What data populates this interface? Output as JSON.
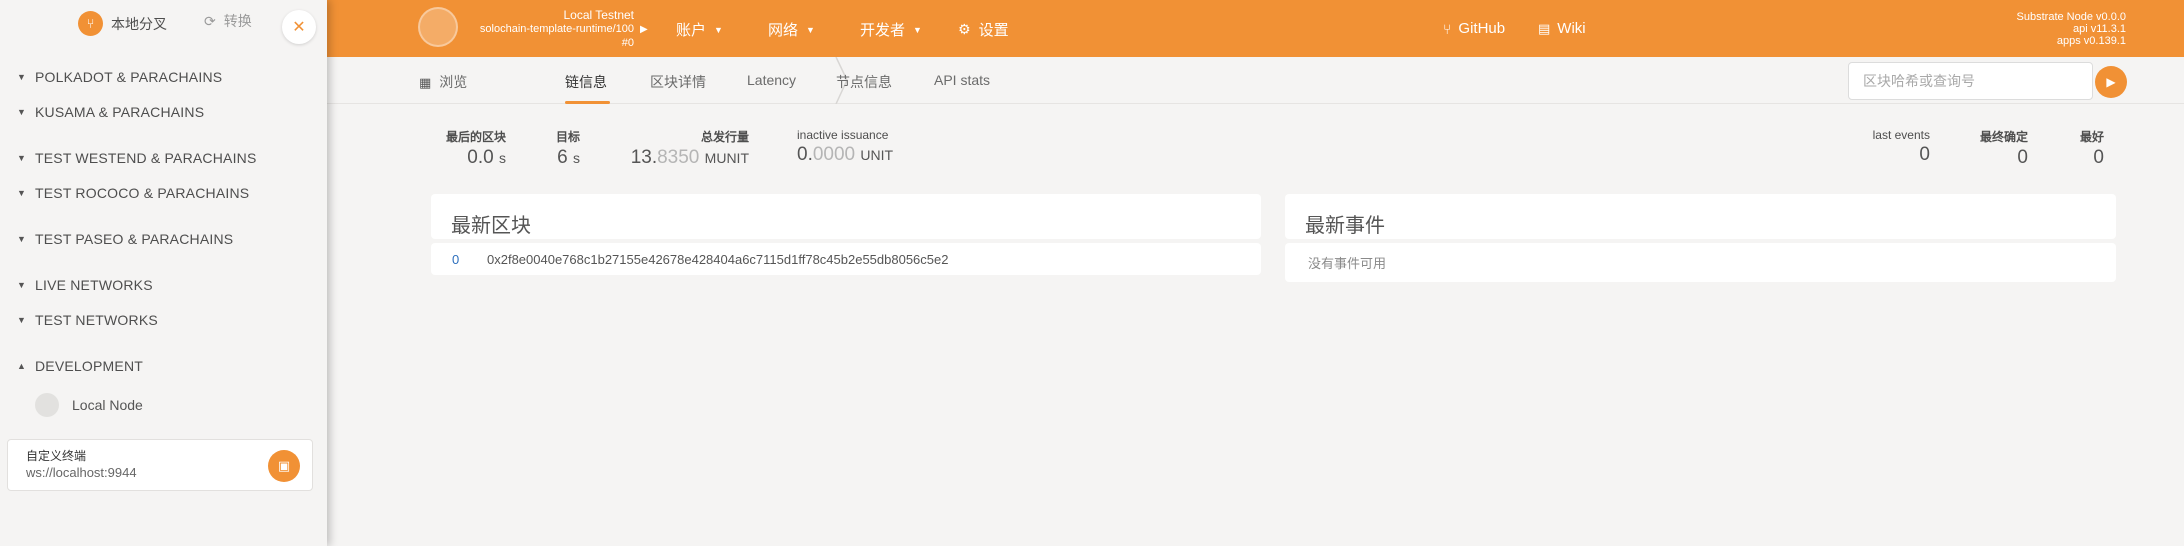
{
  "colors": {
    "accent": "#f19135",
    "background": "#f5f4f3",
    "card": "#ffffff"
  },
  "topbar": {
    "chain_name": "Local Testnet",
    "runtime": "solochain-template-runtime/100",
    "block": "#0",
    "nav": [
      {
        "label": "账户",
        "icon": "chevron-down-icon"
      },
      {
        "label": "网络",
        "icon": "chevron-down-icon"
      },
      {
        "label": "开发者",
        "icon": "chevron-down-icon"
      },
      {
        "label": "设置",
        "icon": "gears-icon"
      }
    ],
    "github": "GitHub",
    "wiki": "Wiki",
    "node_version": "Substrate Node v0.0.0",
    "api_version": "api v11.3.1",
    "apps_version": "apps v0.139.1"
  },
  "tabs": {
    "browse": "浏览",
    "items": [
      "链信息",
      "区块详情",
      "Latency",
      "节点信息",
      "API stats"
    ],
    "active": "链信息"
  },
  "search": {
    "placeholder": "区块哈希或查询号"
  },
  "summary": {
    "last_block": {
      "label": "最后的区块",
      "value": "0.0",
      "unit": "s"
    },
    "target": {
      "label": "目标",
      "value": "6",
      "unit": "s"
    },
    "total_issuance": {
      "label": "总发行量",
      "value_main": "13.",
      "value_dim": "8350",
      "unit": "MUNIT"
    },
    "inactive_issuance": {
      "label": "inactive issuance",
      "value_main": "0.",
      "value_dim": "0000",
      "unit": "UNIT"
    },
    "last_events": {
      "label": "last events",
      "value": "0"
    },
    "finalized": {
      "label": "最终确定",
      "value": "0"
    },
    "best": {
      "label": "最好",
      "value": "0"
    }
  },
  "recent_blocks": {
    "title": "最新区块",
    "rows": [
      {
        "number": "0",
        "hash": "0x2f8e0040e768c1b27155e42678e428404a6c7115d1ff78c45b2e55db8056c5e2"
      }
    ]
  },
  "recent_events": {
    "title": "最新事件",
    "empty": "没有事件可用"
  },
  "sidebar": {
    "local_fork": "本地分叉",
    "switch": "转换",
    "groups": [
      {
        "label": "POLKADOT & PARACHAINS",
        "expanded": false
      },
      {
        "label": "KUSAMA & PARACHAINS",
        "expanded": false
      },
      {
        "label": "TEST WESTEND & PARACHAINS",
        "expanded": false
      },
      {
        "label": "TEST ROCOCO & PARACHAINS",
        "expanded": false
      },
      {
        "label": "TEST PASEO & PARACHAINS",
        "expanded": false
      },
      {
        "label": "LIVE NETWORKS",
        "expanded": false
      },
      {
        "label": "TEST NETWORKS",
        "expanded": false
      },
      {
        "label": "DEVELOPMENT",
        "expanded": true
      }
    ],
    "local_node": "Local Node",
    "custom_endpoint_label": "自定义终端",
    "custom_endpoint_value": "ws://localhost:9944"
  }
}
